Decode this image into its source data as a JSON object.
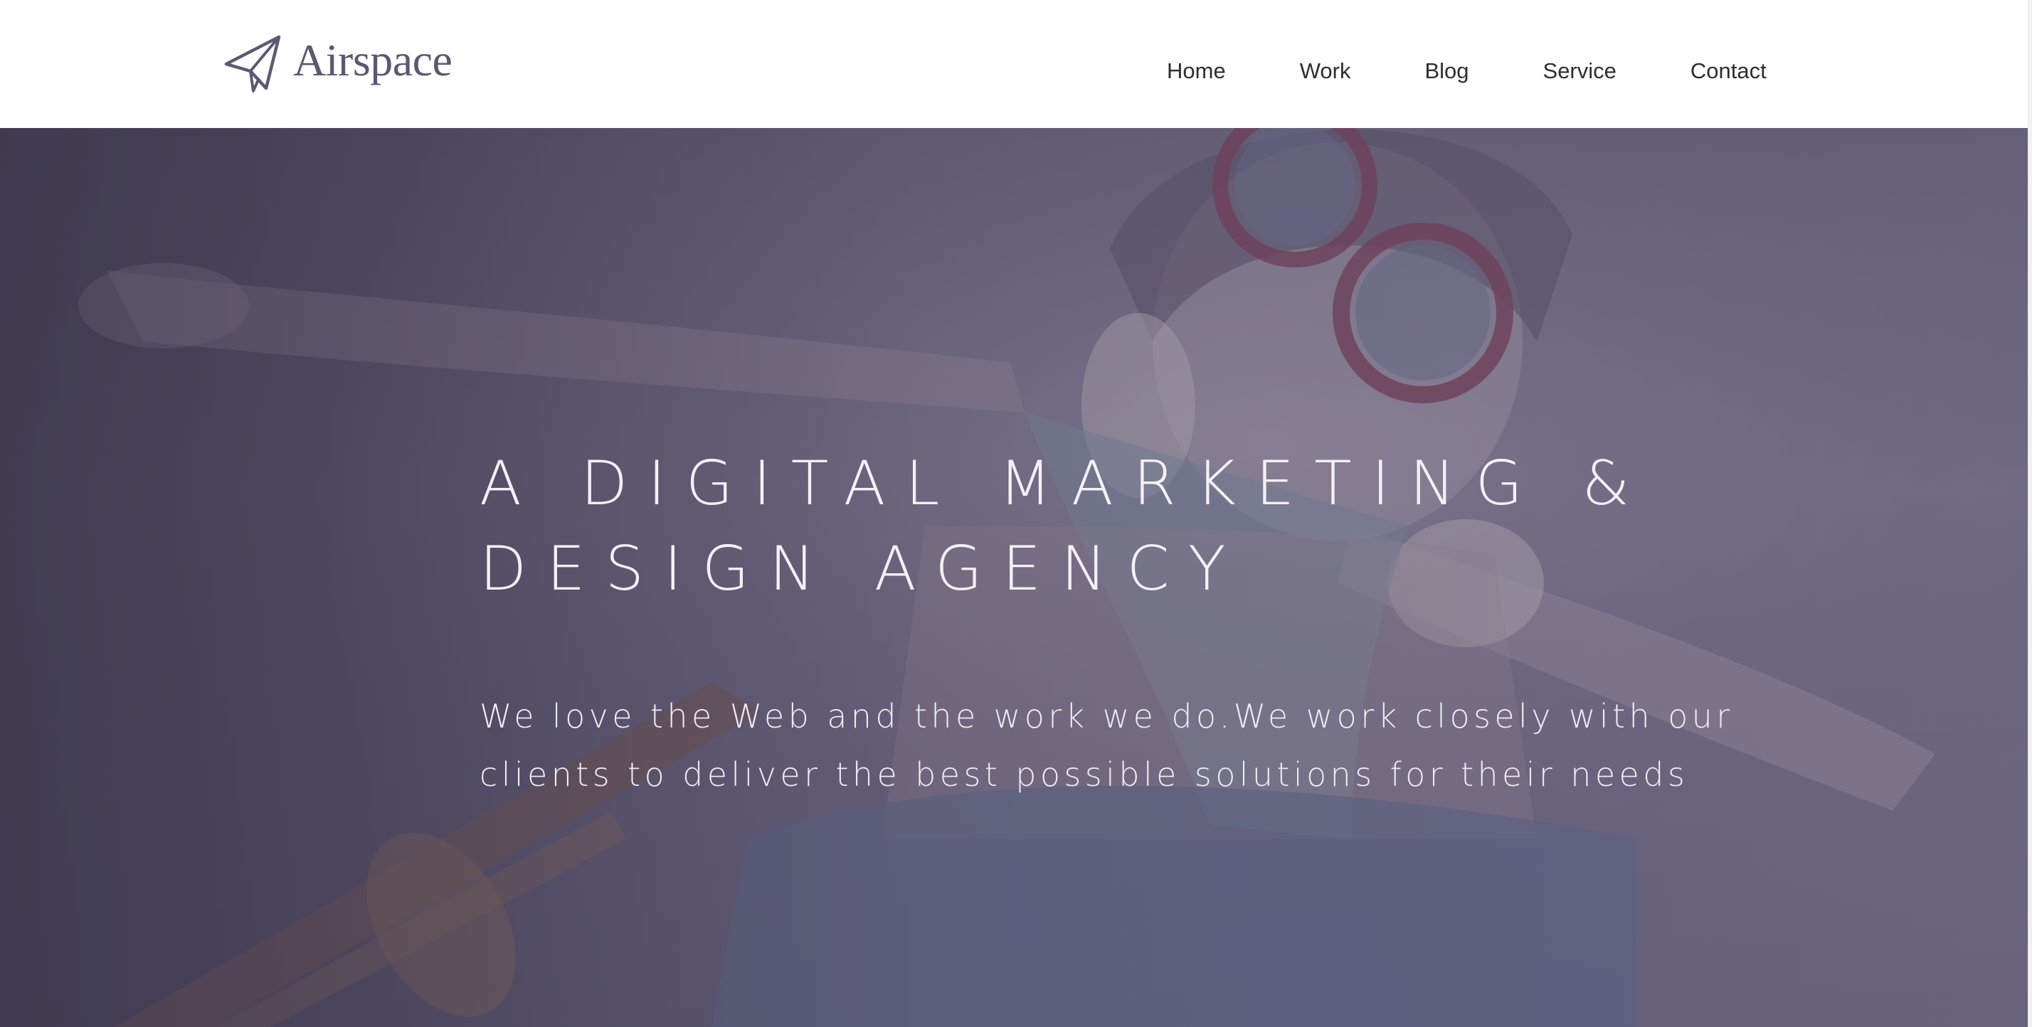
{
  "brand": {
    "name": "Airspace",
    "logo_color": "#5d5872"
  },
  "nav": {
    "items": [
      {
        "label": "Home"
      },
      {
        "label": "Work"
      },
      {
        "label": "Blog"
      },
      {
        "label": "Service"
      },
      {
        "label": "Contact"
      }
    ]
  },
  "hero": {
    "title_line_1": "A DIGITAL MARKETING &",
    "title_line_2": "DESIGN AGENCY",
    "description_line_1": "We love the Web and the work we do.We work closely with our",
    "description_line_2": "clients to deliver the best possible solutions for their needs",
    "overlay_color": "#5a5478",
    "text_color": "#f3f1f7"
  }
}
